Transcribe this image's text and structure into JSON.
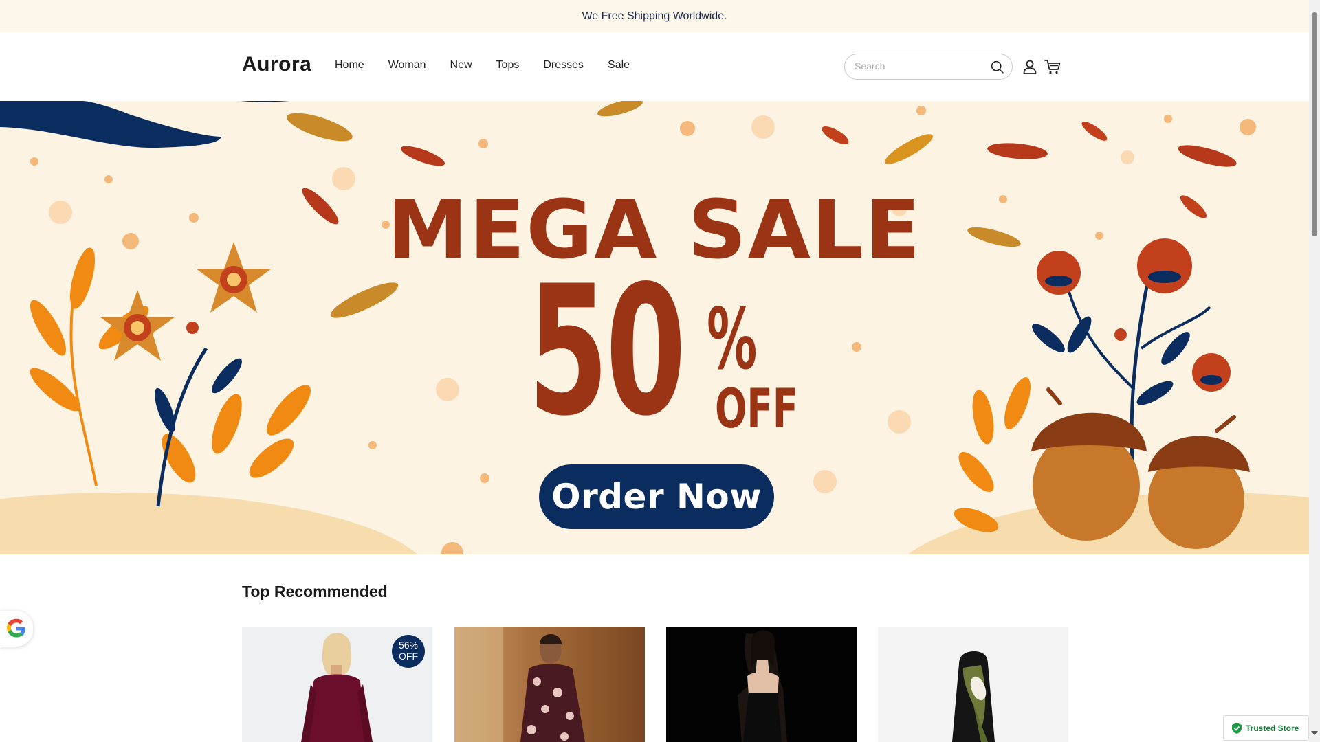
{
  "announcement": {
    "text": "We Free Shipping Worldwide."
  },
  "header": {
    "logo": "Aurora",
    "nav": [
      "Home",
      "Woman",
      "New",
      "Tops",
      "Dresses",
      "Sale"
    ],
    "search_placeholder": "Search",
    "icons": {
      "search": "search-icon",
      "account": "user-icon",
      "cart": "cart-icon"
    }
  },
  "hero": {
    "title": "MEGA SALE",
    "discount_number": "50",
    "discount_percent": "%",
    "discount_suffix": "OFF",
    "cta_label": "Order Now",
    "colors": {
      "background": "#fdf3e2",
      "text": "#9a3414",
      "button": "#0b2c5f"
    }
  },
  "section": {
    "title": "Top Recommended"
  },
  "products": [
    {
      "badge": "56% OFF"
    },
    {},
    {},
    {}
  ],
  "widgets": {
    "google_icon": "google-icon",
    "trusted_store_label": "Trusted Store"
  },
  "colors": {
    "accent": "#0b2c5f",
    "announce_bg": "#fdf6ea",
    "trusted_green": "#1a7a3a"
  }
}
